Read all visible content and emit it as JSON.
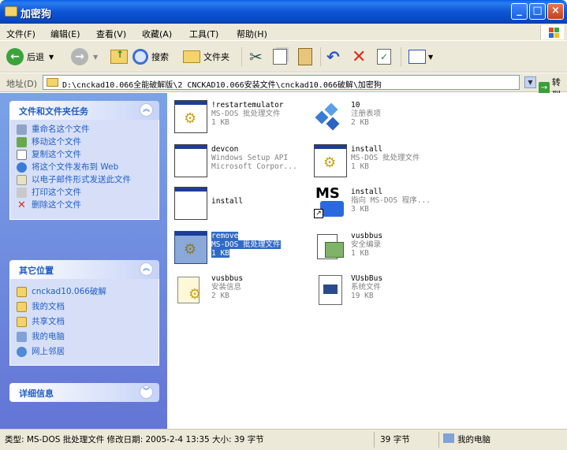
{
  "window": {
    "title": "加密狗"
  },
  "menu": [
    "文件(F)",
    "编辑(E)",
    "查看(V)",
    "收藏(A)",
    "工具(T)",
    "帮助(H)"
  ],
  "toolbar": {
    "back": "后退",
    "search": "搜索",
    "folders": "文件夹"
  },
  "address": {
    "label": "地址(D)",
    "path": "D:\\cnckad10.066全能破解版\\2  CNCKAD10.066安装文件\\cnckad10.066破解\\加密狗",
    "go": "转到"
  },
  "tasks": {
    "title": "文件和文件夹任务",
    "items": [
      "重命名这个文件",
      "移动这个文件",
      "复制这个文件",
      "将这个文件发布到 Web",
      "以电子邮件形式发送此文件",
      "打印这个文件",
      "删除这个文件"
    ]
  },
  "places": {
    "title": "其它位置",
    "items": [
      "cnckad10.066破解",
      "我的文档",
      "共享文档",
      "我的电脑",
      "网上邻居"
    ]
  },
  "details": {
    "title": "详细信息"
  },
  "files": [
    {
      "name": "!restartemulator",
      "type": "MS-DOS 批处理文件",
      "size": "1 KB"
    },
    {
      "name": "10",
      "type": "注册表项",
      "size": "2 KB"
    },
    {
      "name": "devcon",
      "type": "Windows Setup API",
      "size": "Microsoft Corpor..."
    },
    {
      "name": "install",
      "type": "MS-DOS 批处理文件",
      "size": "1 KB"
    },
    {
      "name": "install",
      "type": "",
      "size": ""
    },
    {
      "name": "install",
      "type": "指向 MS-DOS 程序...",
      "size": "3 KB"
    },
    {
      "name": "remove",
      "type": "MS-DOS 批处理文件",
      "size": "1 KB"
    },
    {
      "name": "vusbbus",
      "type": "安全编录",
      "size": "1 KB"
    },
    {
      "name": "vusbbus",
      "type": "安装信息",
      "size": "2 KB"
    },
    {
      "name": "VUsbBus",
      "type": "系统文件",
      "size": "19 KB"
    }
  ],
  "status": {
    "info": "类型: MS-DOS 批处理文件 修改日期: 2005-2-4 13:35 大小: 39 字节",
    "size": "39 字节",
    "location": "我的电脑"
  }
}
